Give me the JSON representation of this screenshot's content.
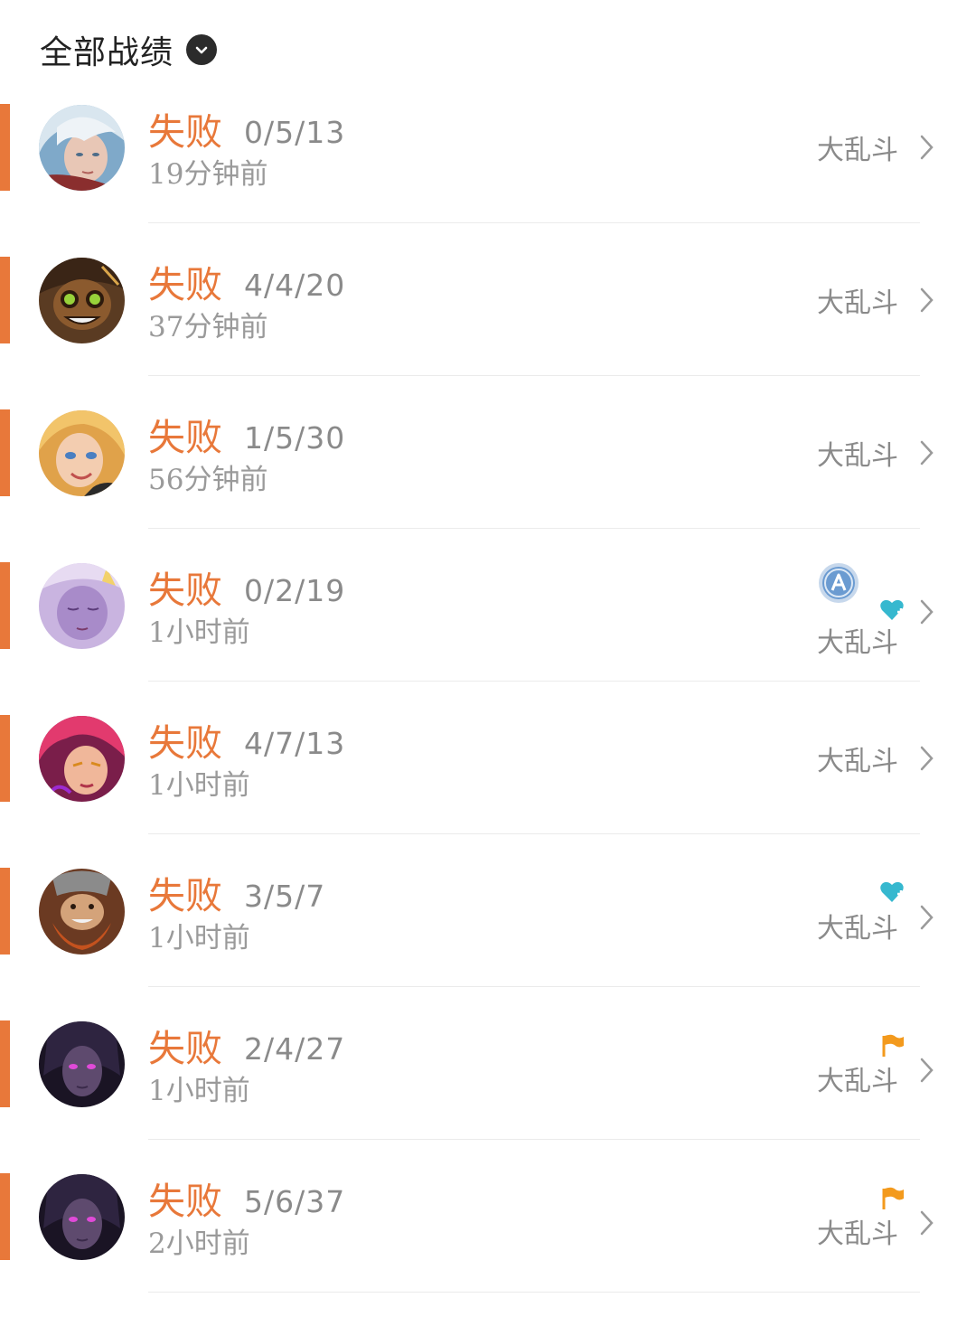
{
  "header": {
    "title": "全部战绩",
    "dropdown_icon": "chevron-down-icon"
  },
  "colors": {
    "accent": "#e8783a",
    "badge_blue": "#6b9bd1",
    "heart": "#36b8cf",
    "flag": "#f39a1d"
  },
  "matches": [
    {
      "result": "失败",
      "kda": "0/5/13",
      "time": "19分钟前",
      "mode": "大乱斗",
      "avatar": "champion-white-hair",
      "extras": []
    },
    {
      "result": "失败",
      "kda": "4/4/20",
      "time": "37分钟前",
      "mode": "大乱斗",
      "avatar": "champion-goggles",
      "extras": []
    },
    {
      "result": "失败",
      "kda": "1/5/30",
      "time": "56分钟前",
      "mode": "大乱斗",
      "avatar": "champion-blonde",
      "extras": []
    },
    {
      "result": "失败",
      "kda": "0/2/19",
      "time": "1小时前",
      "mode": "大乱斗",
      "avatar": "champion-purple-sleeping",
      "extras": [
        "a-badge-icon",
        "heart-plus-icon"
      ]
    },
    {
      "result": "失败",
      "kda": "4/7/13",
      "time": "1小时前",
      "mode": "大乱斗",
      "avatar": "champion-pink-hair",
      "extras": []
    },
    {
      "result": "失败",
      "kda": "3/5/7",
      "time": "1小时前",
      "mode": "大乱斗",
      "avatar": "champion-dwarf",
      "extras": [
        "heart-plus-icon"
      ]
    },
    {
      "result": "失败",
      "kda": "2/4/27",
      "time": "1小时前",
      "mode": "大乱斗",
      "avatar": "champion-dark-glow-eyes",
      "extras": [
        "flag-icon"
      ]
    },
    {
      "result": "失败",
      "kda": "5/6/37",
      "time": "2小时前",
      "mode": "大乱斗",
      "avatar": "champion-dark-glow-eyes",
      "extras": [
        "flag-icon"
      ]
    }
  ]
}
